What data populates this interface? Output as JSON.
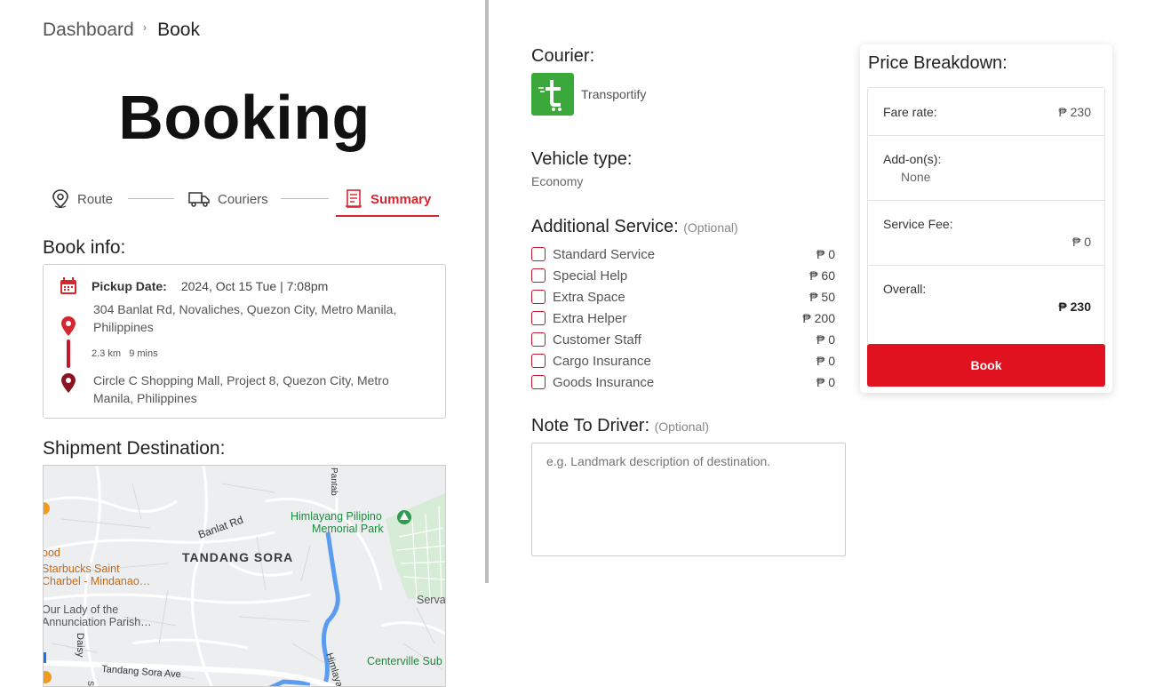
{
  "breadcrumb": {
    "parent": "Dashboard",
    "separator": "›",
    "current": "Book"
  },
  "page_title": "Booking",
  "steps": [
    {
      "label": "Route",
      "icon": "location-pin-icon"
    },
    {
      "label": "Couriers",
      "icon": "truck-icon"
    },
    {
      "label": "Summary",
      "icon": "receipt-icon",
      "active": true
    }
  ],
  "book_info": {
    "heading": "Book info:",
    "pickup_label": "Pickup Date:",
    "pickup_value": "2024, Oct 15 Tue | 7:08pm",
    "origin": "304 Banlat Rd, Novaliches, Quezon City, Metro Manila, Philippines",
    "distance": "2.3 km",
    "duration": "9 mins",
    "destination": "Circle C Shopping Mall, Project 8, Quezon City, Metro Manila, Philippines"
  },
  "shipment": {
    "heading": "Shipment Destination:",
    "map_labels": {
      "area": "TANDANG SORA",
      "road1": "Banlat Rd",
      "road2": "Tandang Sora Ave",
      "road3": "Himlayang",
      "road4": "Pantab",
      "road5": "Daisy",
      "park": "Himlayang Pilipino Memorial Park",
      "poi1": "Starbucks Saint Charbel - Mindanao…",
      "poi2": "Our Lady of the Annunciation Parish…",
      "poi3": "Centerville Sub",
      "poi4": "Servar",
      "poi5": "ood",
      "poi6": "St"
    }
  },
  "courier": {
    "heading": "Courier:",
    "name": "Transportify",
    "logo_color": "#3aa83a"
  },
  "vehicle": {
    "heading": "Vehicle type:",
    "value": "Economy"
  },
  "additional": {
    "heading": "Additional Service:",
    "optional": "(Optional)",
    "items": [
      {
        "label": "Standard Service",
        "price": "₱ 0"
      },
      {
        "label": "Special Help",
        "price": "₱ 60"
      },
      {
        "label": "Extra Space",
        "price": "₱ 50"
      },
      {
        "label": "Extra Helper",
        "price": "₱ 200"
      },
      {
        "label": "Customer Staff",
        "price": "₱ 0"
      },
      {
        "label": "Cargo Insurance",
        "price": "₱ 0"
      },
      {
        "label": "Goods Insurance",
        "price": "₱ 0"
      }
    ]
  },
  "note": {
    "heading": "Note To Driver:",
    "optional": "(Optional)",
    "placeholder": "e.g. Landmark description of destination."
  },
  "price_breakdown": {
    "title": "Price Breakdown:",
    "fare_label": "Fare rate:",
    "fare_value": "₱ 230",
    "addons_label": "Add-on(s):",
    "addons_value": "None",
    "service_fee_label": "Service Fee:",
    "service_fee_value": "₱ 0",
    "overall_label": "Overall:",
    "overall_value": "₱ 230",
    "book_label": "Book"
  },
  "colors": {
    "accent": "#d7262e",
    "button": "#e0121f"
  }
}
